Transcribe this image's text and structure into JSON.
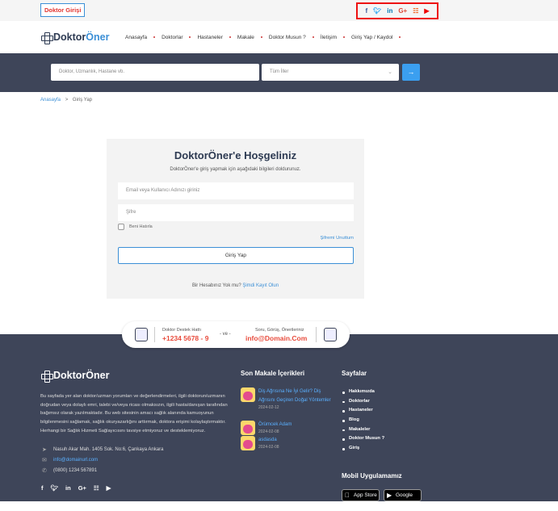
{
  "topbar": {
    "doctor_login": "Doktor Girişi",
    "social": [
      "f",
      "t",
      "in",
      "G+",
      "rss",
      "yt"
    ]
  },
  "brand": {
    "name_main": "Doktor",
    "name_accent": "Öner"
  },
  "nav": {
    "items": [
      "Anasayfa",
      "Doktorlar",
      "Hastaneler",
      "Makale",
      "Doktor Musun ?",
      "İletişim",
      "Giriş Yap / Kaydol"
    ]
  },
  "search": {
    "placeholder": "Doktor, Uzmanlık, Hastane vb.",
    "city_selected": "Tüm İller",
    "submit_icon": "→"
  },
  "breadcrumb": {
    "home": "Anasayfa",
    "sep": ">",
    "current": "Giriş Yap"
  },
  "login": {
    "title": "DoktorÖner'e Hoşgeliniz",
    "subtitle": "DoktorÖner'e giriş yapmak için aşağıdaki bilgileri doldurunuz.",
    "email_placeholder": "Email veya Kullanıcı Adınızı giriniz",
    "password_placeholder": "Şifre",
    "remember": "Beni Hatırla",
    "forgot": "Şifremi Unuttum",
    "submit": "Giriş Yap",
    "register_prompt": "Bir Hesabınız Yok mu?",
    "register_link": "Şimdi Kayıt Olun"
  },
  "support": {
    "phone_label": "Doktor Destek Hattı",
    "phone": "+1234 5678 - 9",
    "connector": "- ve -",
    "email_label": "Soru, Görüş, Önerileriniz",
    "email": "info@Domain.Com"
  },
  "footer": {
    "description": "Bu sayfada yer alan doktor/uzman yorumları ve değerlendirmeleri, ilgili doktorun/uzmanın doğrudan veya dolaylı emri, talebi ve/veya ricası olmaksızın, ilgili hasta/danışan tarafından bağımsız olarak yazılmaktadır. Bu web sitesinin amacı sağlık alanında kamuoyunun bilgilenmesini sağlamak, sağlık okuryazarlığını arttırmak, doktora erişimi kolaylaştırmaktır. Herhangi bir Sağlık Hizmeti Sağlayıcısını tavsiye etmiyoruz ve desteklemiyoruz.",
    "address": "Nasuh Akar Mah. 1405 Sok. No:6, Çankaya Ankara",
    "email": "info@domainurl.com",
    "phone": "(0800) 1234 567891",
    "social": [
      "f",
      "t",
      "in",
      "G+",
      "rss",
      "yt"
    ],
    "articles_title": "Son Makale İçerikleri",
    "articles": [
      {
        "title": "Diş Ağrısına Ne İyi Gelir? Diş Ağrısını Geçiren Doğal Yöntemler",
        "date": "2024-02-12"
      },
      {
        "title": "Örümcek Adam",
        "date": "2024-02-08"
      },
      {
        "title": "asdasda",
        "date": "2024-02-08"
      }
    ],
    "pages_title": "Sayfalar",
    "pages": [
      "Hakkımızda",
      "Doktorlar",
      "Hastaneler",
      "Blog",
      "Makaleler",
      "Doktor Musun ?",
      "Giriş"
    ],
    "app_title": "Mobil Uygulamamız",
    "app_store": "App Store",
    "play_store": "Google play"
  },
  "colors": {
    "accent": "#3b8fd6",
    "dark": "#3e4559",
    "danger": "#e84c3d"
  }
}
